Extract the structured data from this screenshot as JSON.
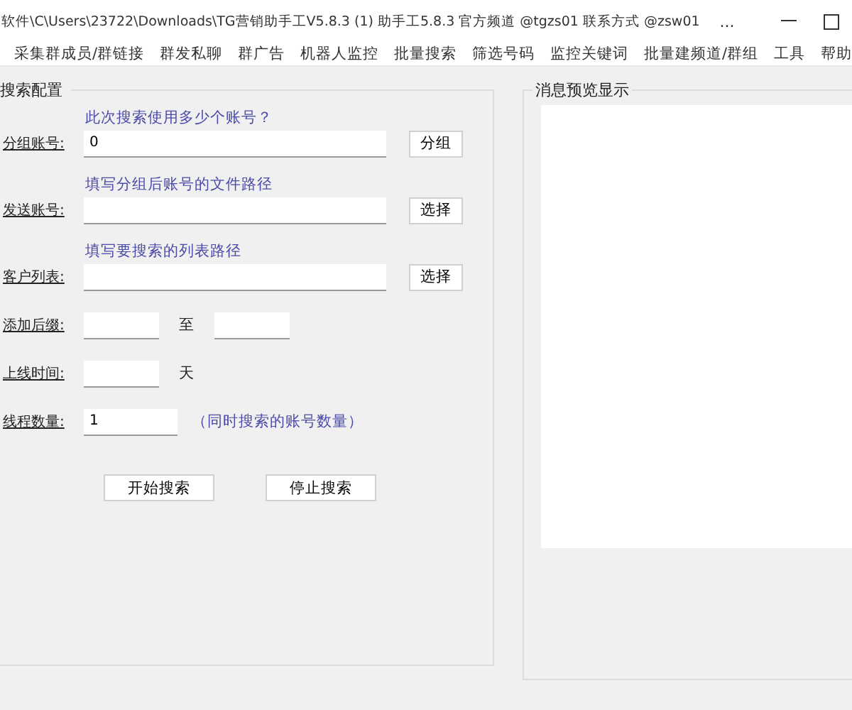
{
  "window": {
    "title": "软件\\C\\Users\\23722\\Downloads\\TG营销助手工V5.8.3 (1)  助手工5.8.3  官方频道 @tgzs01 联系方式 @zsw01",
    "more": "..."
  },
  "menu": [
    "采集群成员/群链接",
    "群发私聊",
    "群广告",
    "机器人监控",
    "批量搜索",
    "筛选号码",
    "监控关键词",
    "批量建频道/群组",
    "工具",
    "帮助"
  ],
  "config": {
    "title": "搜索配置",
    "path_rows": [
      {
        "label": "分组账号:",
        "hint": "此次搜索使用多少个账号？",
        "value": "0",
        "button": "分组"
      },
      {
        "label": "发送账号:",
        "hint": "填写分组后账号的文件路径",
        "value": "",
        "button": "选择"
      },
      {
        "label": "客户列表:",
        "hint": "填写要搜索的列表路径",
        "value": "",
        "button": "选择"
      }
    ],
    "suffix": {
      "label": "添加后缀:",
      "joiner": "至"
    },
    "online": {
      "label": "上线时间:",
      "unit": "天"
    },
    "threads": {
      "label": "线程数量:",
      "value": "1",
      "hint": "（同时搜索的账号数量）"
    },
    "buttons": [
      "开始搜索",
      "停止搜索"
    ]
  },
  "preview": {
    "title": "消息预览显示"
  }
}
